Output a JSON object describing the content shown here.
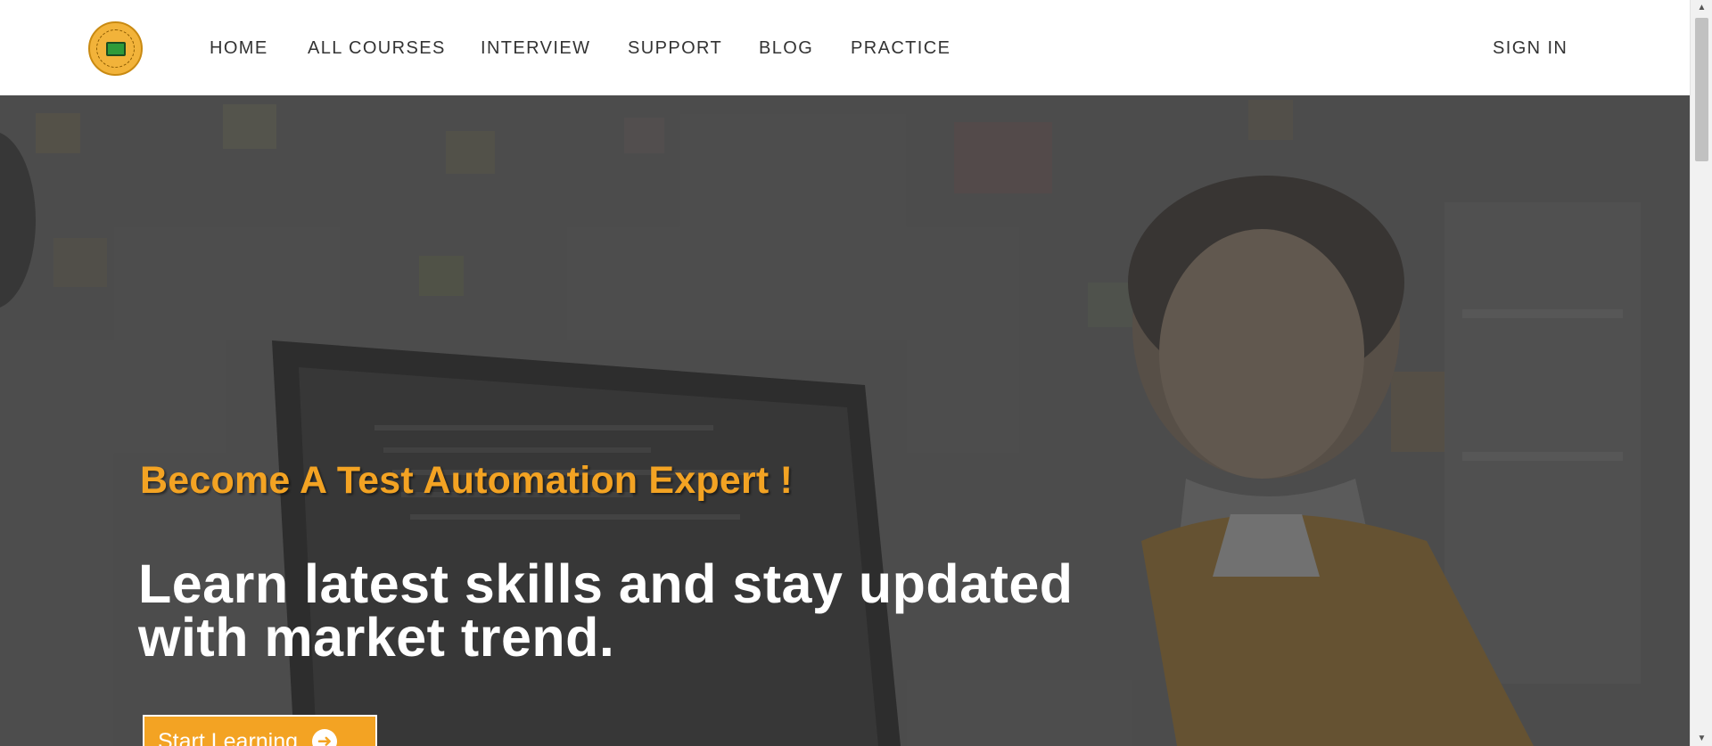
{
  "header": {
    "logo_alt": "logo",
    "nav": [
      {
        "label": "HOME"
      },
      {
        "label": "ALL COURSES"
      },
      {
        "label": "INTERVIEW"
      },
      {
        "label": "SUPPORT"
      },
      {
        "label": "BLOG"
      },
      {
        "label": "PRACTICE"
      }
    ],
    "sign_in_label": "SIGN IN"
  },
  "hero": {
    "tagline": "Become A Test Automation Expert !",
    "title": "Learn latest skills and stay updated with market trend.",
    "cta_label": "Start Learning",
    "cta_icon": "arrow-circle-right-icon"
  },
  "colors": {
    "accent": "#f3a323",
    "nav_text": "#333333",
    "hero_text": "#ffffff"
  }
}
